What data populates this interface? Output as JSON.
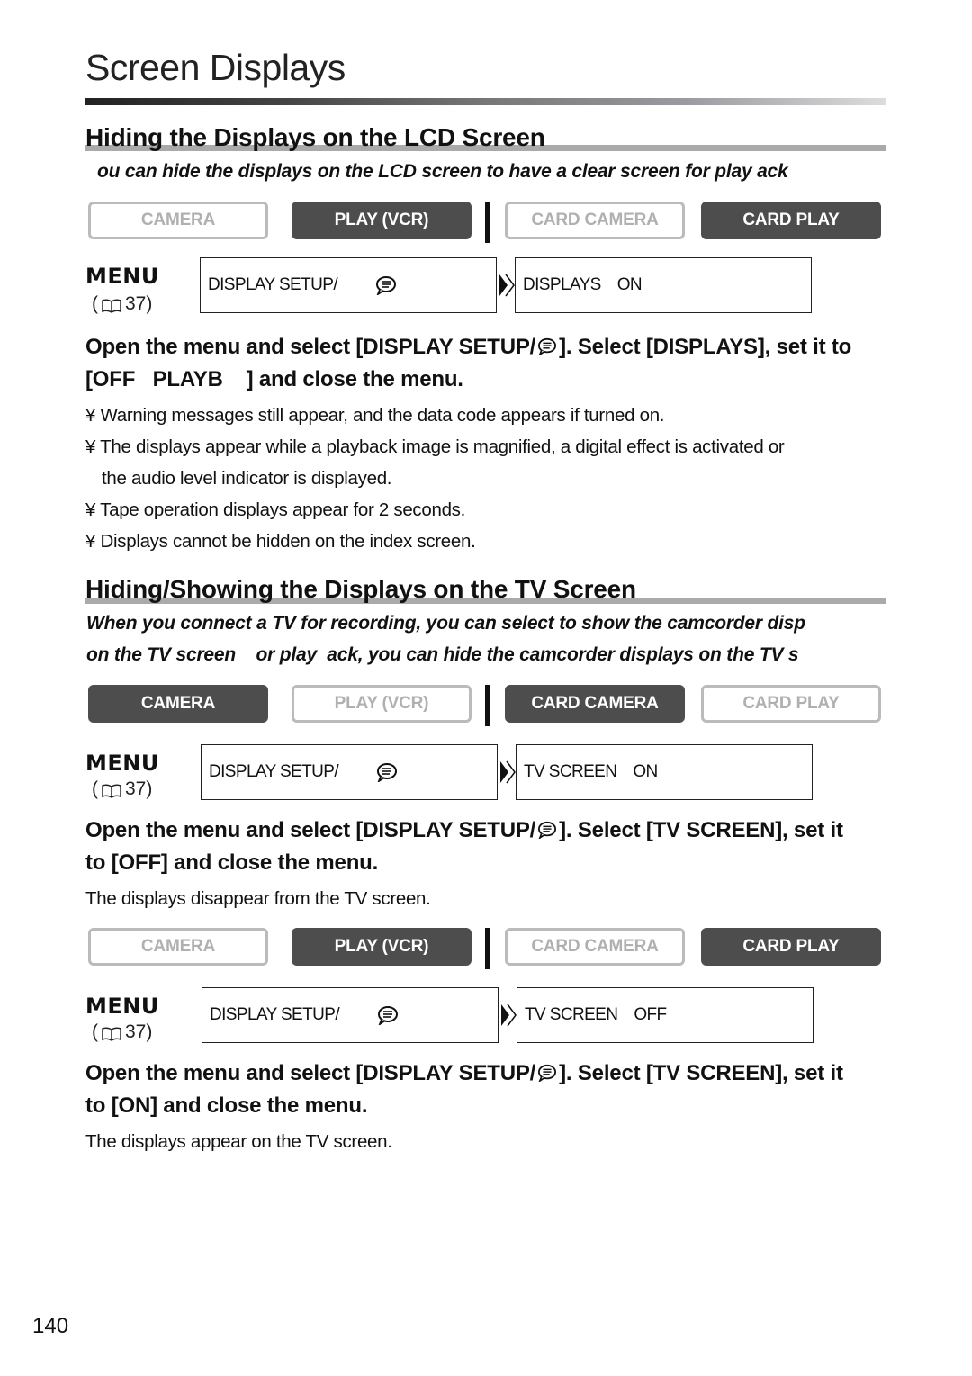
{
  "page": {
    "title": "Screen Displays",
    "page_number": "140"
  },
  "mode_labels": [
    "CAMERA",
    "PLAY (VCR)",
    "CARD CAMERA",
    "CARD PLAY"
  ],
  "menu": {
    "label": "MENU",
    "ref_open": "(",
    "ref_page": "37)",
    "book_icon": "book-icon",
    "menu_item": "DISPLAY SETUP/",
    "menu_item_icon": "speech-bubble-icon",
    "arrow_icon": "double-chevron-right-icon"
  },
  "section1": {
    "heading": "Hiding the Displays on the LCD Screen",
    "intro": "ou can hide the displays on the LCD screen to have a clear screen for play  ack",
    "modes_active": [
      false,
      true,
      false,
      true
    ],
    "submenu_setting": "DISPLAYS",
    "submenu_value": "ON",
    "step_part1": "Open the menu and select [DISPLAY SETUP/",
    "step_part2": "]. Select [DISPLAYS], set it to",
    "step_line2": "[OFF   PLAYB    ] and close the menu.",
    "bullets": [
      {
        "mark": "¥",
        "text": "Warning messages still appear, and the data code appears if turned on."
      },
      {
        "mark": "¥",
        "text": "The displays appear while a playback image is magnified, a digital effect is activated or"
      },
      {
        "mark": "",
        "text": "the audio level indicator is displayed."
      },
      {
        "mark": "¥",
        "text": "Tape operation displays appear for 2 seconds."
      },
      {
        "mark": "¥",
        "text": "Displays cannot be hidden on the index screen."
      }
    ]
  },
  "section2": {
    "heading": "Hiding/Showing the Displays on the TV Screen",
    "intro_line1": "When you connect a TV for recording, you can select to show the camcorder disp",
    "intro_line2": "on the TV screen    or play  ack, you can hide the camcorder displays on the TV s",
    "block1": {
      "modes_active": [
        true,
        false,
        true,
        false
      ],
      "submenu_setting": "TV SCREEN",
      "submenu_value": "ON",
      "step_part1": "Open the menu and select [DISPLAY SETUP/",
      "step_part2": "]. Select [TV SCREEN], set it",
      "step_line2": "to [OFF] and close the menu.",
      "note": "The displays disappear from the TV screen."
    },
    "block2": {
      "modes_active": [
        false,
        true,
        false,
        true
      ],
      "submenu_setting": "TV SCREEN",
      "submenu_value": "OFF",
      "step_part1": "Open the menu and select [DISPLAY SETUP/",
      "step_part2": "]. Select [TV SCREEN], set it",
      "step_line2": "to [ON] and close the menu.",
      "note": "The displays appear on the TV screen."
    }
  }
}
